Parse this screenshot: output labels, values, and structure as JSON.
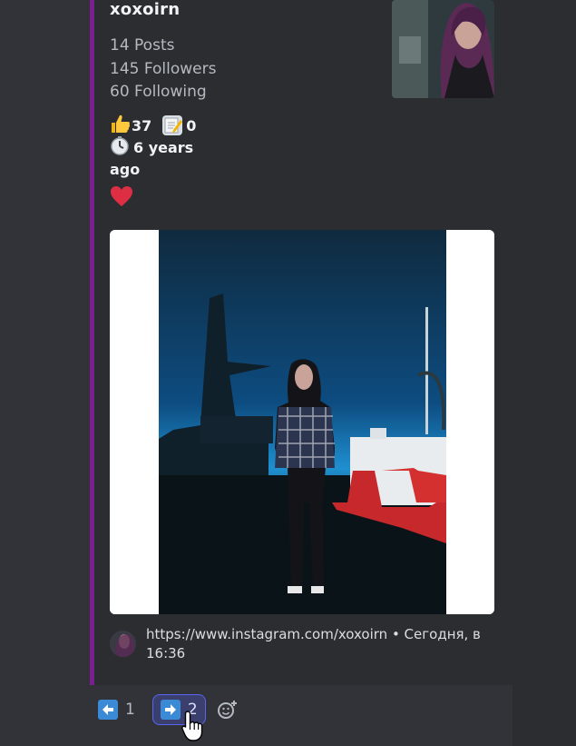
{
  "profile": {
    "username": "xoxoirn",
    "posts": "14 Posts",
    "followers": "145 Followers",
    "following": "60 Following",
    "likes_count": "37",
    "edits_count": "0",
    "age_line1": "6 years",
    "age_line2": "ago"
  },
  "footer": {
    "text": "https://www.instagram.com/xoxoirn • Сегодня, в 16:36"
  },
  "reactions": [
    {
      "icon": "arrow-left-icon",
      "count": "1"
    },
    {
      "icon": "arrow-right-icon",
      "count": "2"
    }
  ],
  "colors": {
    "embed_accent": "#7a1f8f",
    "reaction_active_border": "#5865f2"
  }
}
